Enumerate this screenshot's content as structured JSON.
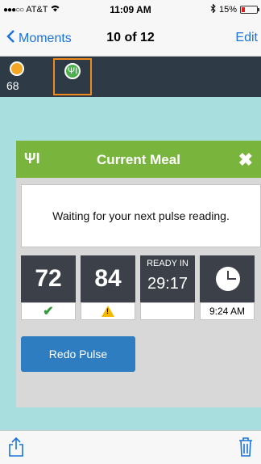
{
  "status_bar": {
    "signal": "●●●○○",
    "carrier": "AT&T",
    "time": "11:09 AM",
    "battery": "15%"
  },
  "nav": {
    "back_label": "Moments",
    "title": "10 of 12",
    "edit_label": "Edit"
  },
  "moments": {
    "sun_value": "68",
    "meal_icon": "fork-knife-icon"
  },
  "dialog": {
    "title": "Current Meal",
    "message": "Waiting for your next pulse reading.",
    "tiles": [
      {
        "value": "72",
        "status": "check"
      },
      {
        "value": "84",
        "status": "warning"
      },
      {
        "label": "READY IN",
        "value": "29:17"
      },
      {
        "value": "",
        "caption": "9:24 AM"
      }
    ],
    "redo_label": "Redo Pulse"
  },
  "colors": {
    "header_green": "#79b43c",
    "button_blue": "#2d7dc0",
    "selection_orange": "#f08a1c"
  }
}
